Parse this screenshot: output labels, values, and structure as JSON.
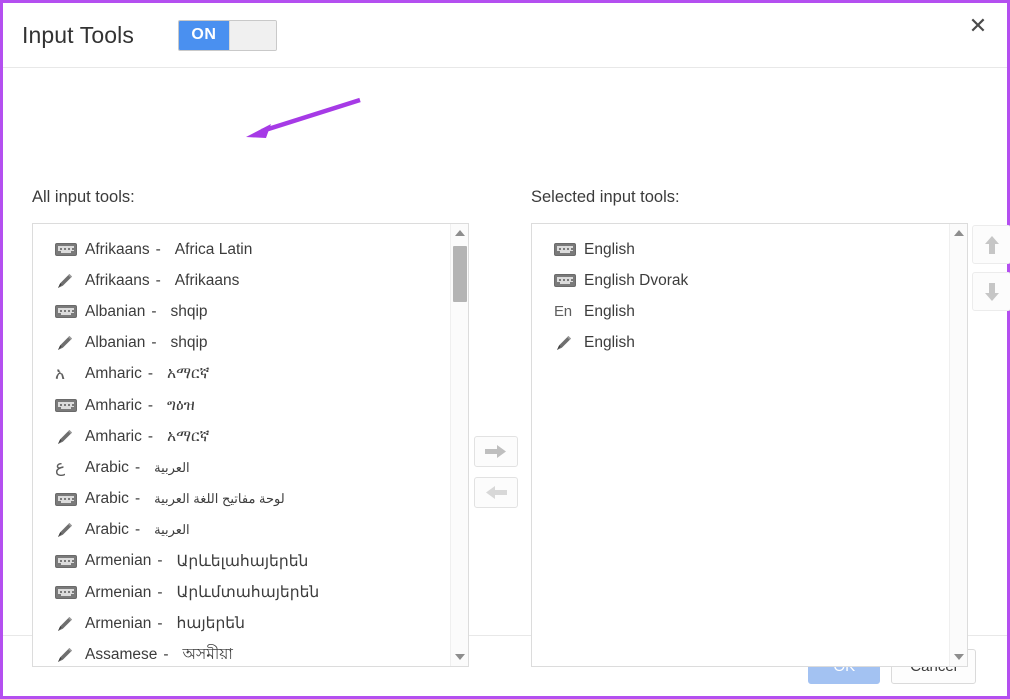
{
  "dialog": {
    "border_color": "#b44ff0",
    "title": "Input Tools",
    "close_icon": "close-icon"
  },
  "toggle": {
    "state_label": "ON",
    "on_color": "#4a90f0"
  },
  "panels": {
    "all_label": "All input tools:",
    "selected_label": "Selected input tools:"
  },
  "all_input_tools": [
    {
      "icon": "keyboard-icon",
      "language": "Afrikaans",
      "dash": "-",
      "native": "Africa Latin"
    },
    {
      "icon": "handwriting-icon",
      "language": "Afrikaans",
      "dash": "-",
      "native": "Afrikaans"
    },
    {
      "icon": "keyboard-icon",
      "language": "Albanian",
      "dash": "-",
      "native": "shqip"
    },
    {
      "icon": "handwriting-icon",
      "language": "Albanian",
      "dash": "-",
      "native": "shqip"
    },
    {
      "icon": "script-glyph-icon",
      "glyph": "አ",
      "language": "Amharic",
      "dash": "-",
      "native": "አማርኛ"
    },
    {
      "icon": "keyboard-icon",
      "language": "Amharic",
      "dash": "-",
      "native": "ግዕዝ"
    },
    {
      "icon": "handwriting-icon",
      "language": "Amharic",
      "dash": "-",
      "native": "አማርኛ"
    },
    {
      "icon": "script-glyph-icon",
      "glyph": "ع",
      "language": "Arabic",
      "dash": "-",
      "native": "العربية",
      "rtl": true
    },
    {
      "icon": "keyboard-icon",
      "language": "Arabic",
      "dash": "-",
      "native": "لوحة مفاتيح اللغة العربية",
      "rtl": true
    },
    {
      "icon": "handwriting-icon",
      "language": "Arabic",
      "dash": "-",
      "native": "العربية",
      "rtl": true
    },
    {
      "icon": "keyboard-icon",
      "language": "Armenian",
      "dash": "-",
      "native": "Արևելահայերեն"
    },
    {
      "icon": "keyboard-icon",
      "language": "Armenian",
      "dash": "-",
      "native": "Արևմտահայերեն"
    },
    {
      "icon": "handwriting-icon",
      "language": "Armenian",
      "dash": "-",
      "native": "հայերեն"
    },
    {
      "icon": "handwriting-icon",
      "language": "Assamese",
      "dash": "-",
      "native": "অসমীয়া"
    }
  ],
  "selected_input_tools": [
    {
      "icon": "keyboard-icon",
      "language": "English"
    },
    {
      "icon": "keyboard-icon",
      "language": "English Dvorak"
    },
    {
      "icon": "transliteration-icon",
      "glyph": "En",
      "language": "English"
    },
    {
      "icon": "handwriting-icon",
      "language": "English"
    }
  ],
  "transfer": {
    "add_icon": "arrow-right-icon",
    "remove_icon": "arrow-left-icon"
  },
  "reorder": {
    "move_up_icon": "arrow-up-icon",
    "move_down_icon": "arrow-down-icon"
  },
  "scrollbars": {
    "up_icon": "scroll-up-arrow-icon",
    "down_icon": "scroll-down-arrow-icon"
  },
  "footer": {
    "ok_label": "OK",
    "cancel_label": "Cancel"
  },
  "annotation": {
    "color": "#a63ae6",
    "shape": "arrow"
  }
}
